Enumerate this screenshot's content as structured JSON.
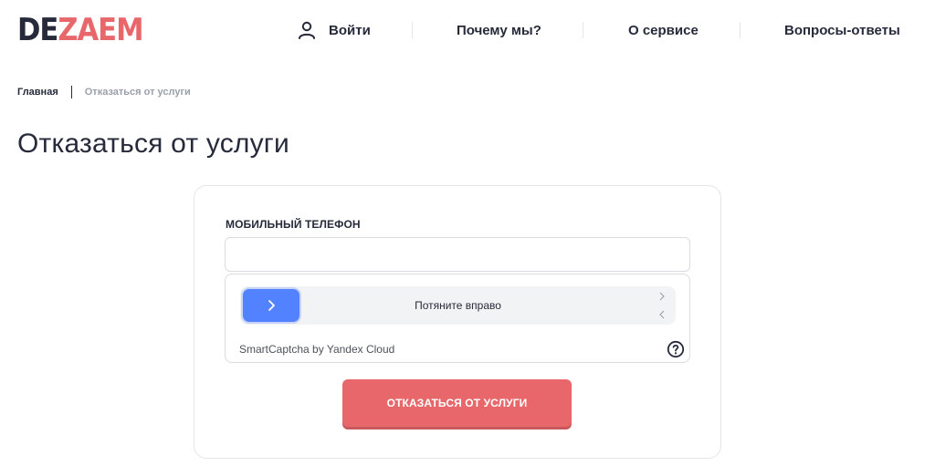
{
  "logo": {
    "part1": "DE",
    "part2": "ZAEM"
  },
  "nav": {
    "login_label": "Войти",
    "items": [
      {
        "label": "Почему мы?"
      },
      {
        "label": "О сервисе"
      },
      {
        "label": "Вопросы-ответы"
      }
    ]
  },
  "breadcrumb": {
    "home": "Главная",
    "current": "Отказаться от услуги"
  },
  "page": {
    "title": "Отказаться от услуги"
  },
  "form": {
    "phone_label": "МОБИЛЬНЫЙ ТЕЛЕФОН",
    "phone_value": "",
    "captcha": {
      "slider_text": "Потяните вправо",
      "brand": "SmartCaptcha by Yandex Cloud",
      "icons": {
        "handle": "chevron-right-icon",
        "help": "help-circle-icon"
      }
    },
    "submit_label": "ОТКАЗАТЬСЯ ОТ УСЛУГИ"
  },
  "colors": {
    "brand_dark": "#262a3a",
    "brand_red": "#e8676b",
    "captcha_blue": "#5282ff"
  }
}
